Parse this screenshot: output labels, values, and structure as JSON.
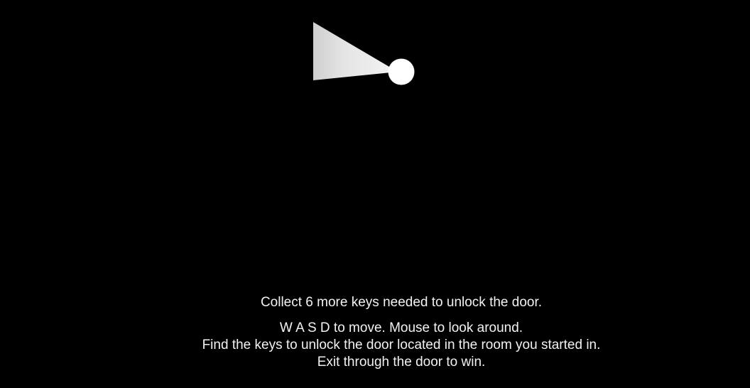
{
  "hud": {
    "status_message": "Collect 6 more keys needed to unlock the door.",
    "instructions": {
      "line1": "W A S D to move. Mouse to look around.",
      "line2": "Find the keys to unlock the door located in the room you started in.",
      "line3": "Exit through the door to win."
    }
  },
  "scene": {
    "background_color": "#000000",
    "player_color": "#ffffff",
    "flashlight_color": "#e6e6e6"
  }
}
